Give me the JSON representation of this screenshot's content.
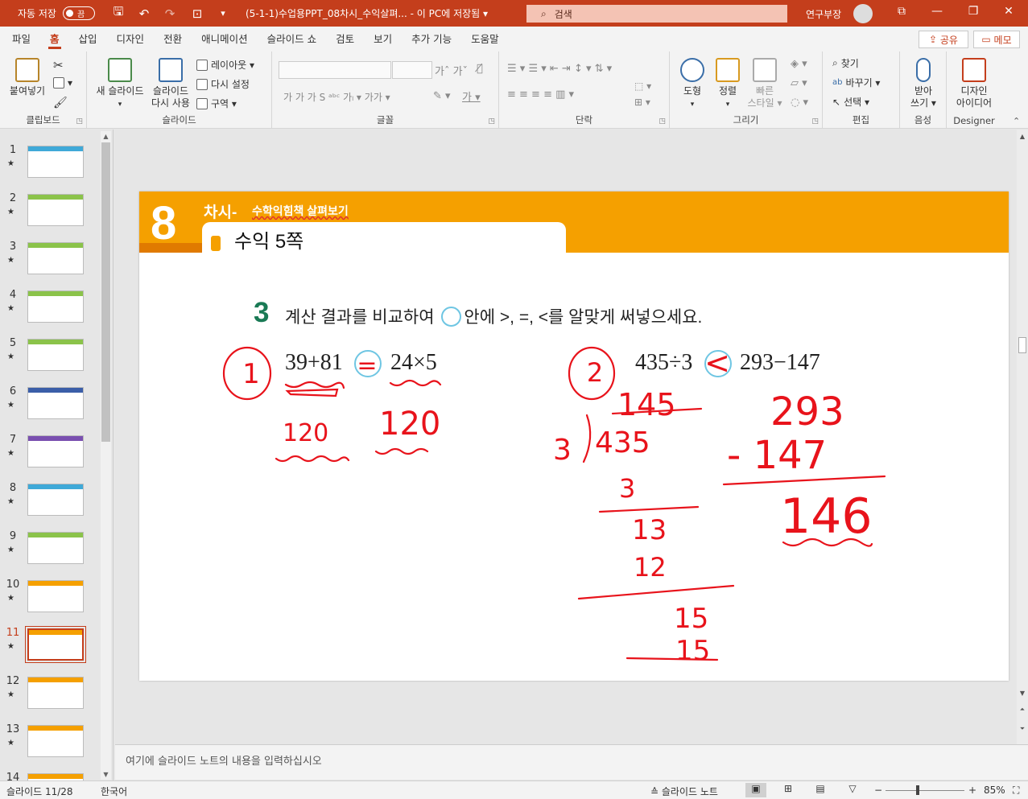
{
  "titlebar": {
    "autosave_label": "자동 저장",
    "autosave_state": "끔",
    "document_title": "(5-1-1)수업용PPT_08차시_수익살펴...  -  이 PC에 저장됨 ▾",
    "search_placeholder": "검색",
    "user_name": "연구부장"
  },
  "ribbon_tabs": [
    "파일",
    "홈",
    "삽입",
    "디자인",
    "전환",
    "애니메이션",
    "슬라이드 쇼",
    "검토",
    "보기",
    "추가 기능",
    "도움말"
  ],
  "active_tab": "홈",
  "share_label": "공유",
  "memo_label": "메모",
  "ribbon": {
    "clipboard": {
      "paste": "붙여넣기",
      "label": "클립보드"
    },
    "slides": {
      "new_slide": "새 슬라이드",
      "reuse_line1": "슬라이드",
      "reuse_line2": "다시 사용",
      "layout": "레이아웃 ▾",
      "reset": "다시 설정",
      "section": "구역 ▾",
      "label": "슬라이드"
    },
    "font": {
      "label": "글꼴"
    },
    "paragraph": {
      "label": "단락"
    },
    "drawing": {
      "shapes": "도형",
      "arrange": "정렬",
      "quick_line1": "빠른",
      "quick_line2": "스타일 ▾",
      "label": "그리기"
    },
    "editing": {
      "find": "찾기",
      "replace": "바꾸기 ▾",
      "select": "선택 ▾",
      "label": "편집"
    },
    "voice": {
      "dictate_line1": "받아",
      "dictate_line2": "쓰기 ▾",
      "label": "음성"
    },
    "designer": {
      "ideas_line1": "디자인",
      "ideas_line2": "아이디어",
      "label": "Designer"
    }
  },
  "thumbnails": [
    {
      "num": "1",
      "band": "#3fa9d8"
    },
    {
      "num": "2",
      "band": "#8bc34a"
    },
    {
      "num": "3",
      "band": "#8bc34a"
    },
    {
      "num": "4",
      "band": "#8bc34a"
    },
    {
      "num": "5",
      "band": "#8bc34a"
    },
    {
      "num": "6",
      "band": "#3b5ea8"
    },
    {
      "num": "7",
      "band": "#7a4fb0"
    },
    {
      "num": "8",
      "band": "#3fa9d8"
    },
    {
      "num": "9",
      "band": "#8bc34a"
    },
    {
      "num": "10",
      "band": "#f5a000"
    },
    {
      "num": "11",
      "band": "#f5a000"
    },
    {
      "num": "12",
      "band": "#f5a000"
    },
    {
      "num": "13",
      "band": "#f5a000"
    },
    {
      "num": "14",
      "band": "#f5a000"
    }
  ],
  "selected_slide": "11",
  "slide": {
    "lesson_number": "8",
    "lesson_label": "차시-",
    "lesson_subtitle": "수학익힘책 살펴보기",
    "page_title": "수익 5쪽",
    "question_number": "3",
    "question_part1": "계산 결과를 비교하여",
    "question_part2": "안에 >, =, <를 알맞게 써넣으세요.",
    "problem1_left": "39+81",
    "problem1_right": "24×5",
    "problem2_left": "435÷3",
    "problem2_right": "293−147",
    "handwriting": {
      "p1_circle": "1",
      "p1_answer": "=",
      "p1_left_value": "120",
      "p1_right_value": "120",
      "p2_circle": "2",
      "p2_answer": "<",
      "quotient": "145",
      "divisor": "3",
      "dividend": "435",
      "step1": "3",
      "step2": "13",
      "step3": "12",
      "step4": "15",
      "step5": "15",
      "sub_top": "293",
      "sub_bottom": "- 147",
      "sub_result": "146"
    }
  },
  "notes_placeholder": "여기에 슬라이드 노트의 내용을 입력하십시오",
  "status": {
    "slide_counter": "슬라이드 11/28",
    "language": "한국어",
    "notes_button": "≙ 슬라이드 노트",
    "zoom_minus": "−",
    "zoom_plus": "+",
    "zoom_level": "85%"
  }
}
